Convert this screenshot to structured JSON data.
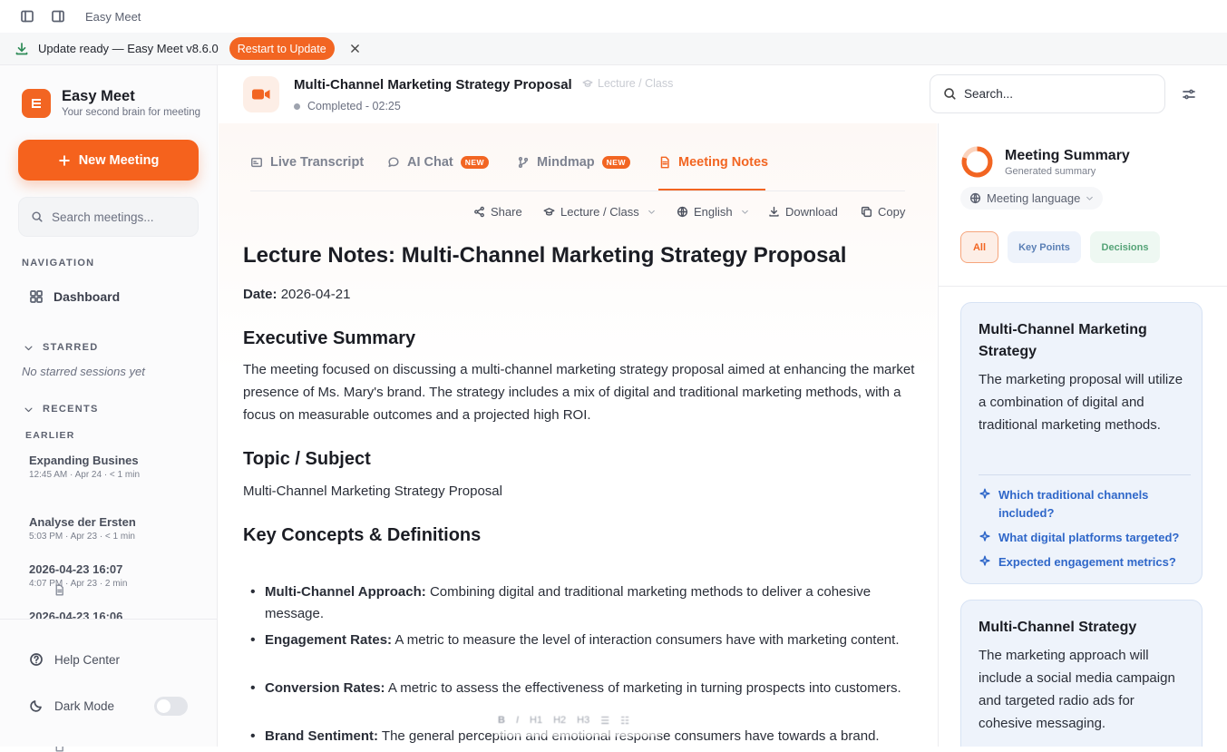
{
  "window": {
    "title": "Easy Meet"
  },
  "banner": {
    "message": "Update ready — Easy Meet v8.6.0",
    "restart_label": "Restart to Update"
  },
  "brand": {
    "name": "Easy Meet",
    "tagline": "Your second brain for meeting"
  },
  "sidebar": {
    "new_meeting_label": "New Meeting",
    "search_placeholder": "Search meetings...",
    "navigation_label": "NAVIGATION",
    "dashboard_label": "Dashboard",
    "starred_label": "STARRED",
    "no_starred": "No starred sessions yet",
    "recents_label": "RECENTS",
    "earlier_label": "EARLIER",
    "recents": [
      {
        "title": "Expanding Busines",
        "meta": "12:45 AM · Apr 24 · < 1 min"
      },
      {
        "title": "Analyse der Ersten",
        "meta": "5:03 PM · Apr 23 · < 1 min"
      },
      {
        "title": "2026-04-23 16:07",
        "meta": "4:07 PM · Apr 23 · 2 min"
      },
      {
        "title": "2026-04-23 16:06",
        "meta": ""
      }
    ],
    "help_label": "Help Center",
    "dark_mode_label": "Dark Mode",
    "dark_mode_on": false
  },
  "meeting": {
    "title": "Multi-Channel Marketing Strategy Proposal",
    "type_tag": "Lecture / Class",
    "status": "Completed - 02:25"
  },
  "tabs": [
    {
      "label": "Live Transcript",
      "badge": ""
    },
    {
      "label": "AI Chat",
      "badge": "NEW"
    },
    {
      "label": "Mindmap",
      "badge": "NEW"
    },
    {
      "label": "Meeting Notes",
      "badge": ""
    }
  ],
  "active_tab": "Meeting Notes",
  "toolbar": {
    "share": "Share",
    "template": "Lecture / Class",
    "language": "English",
    "download": "Download",
    "copy": "Copy"
  },
  "notes": {
    "heading": "Lecture Notes: Multi-Channel Marketing Strategy Proposal",
    "date_label": "Date:",
    "date_value": "2026-04-21",
    "exec_heading": "Executive Summary",
    "exec_lines": [
      "The meeting focused on discussing a multi-channel marketing strategy proposal aimed at enhancing the market",
      "presence of Ms. Mary's brand. The strategy includes a mix of digital and traditional marketing methods, with a",
      "focus on measurable outcomes and a projected high ROI."
    ],
    "topic_heading": "Topic / Subject",
    "topic_text": "Multi-Channel Marketing Strategy Proposal",
    "concepts_heading": "Key Concepts & Definitions",
    "concepts": [
      {
        "term": "Multi-Channel Approach:",
        "def": "Combining digital and traditional marketing methods to deliver a cohesive message."
      },
      {
        "term": "Engagement Rates:",
        "def": "A metric to measure the level of interaction consumers have with marketing content."
      },
      {
        "term": "Conversion Rates:",
        "def": "A metric to assess the effectiveness of marketing in turning prospects into customers."
      },
      {
        "term": "Brand Sentiment:",
        "def": "The general perception and emotional response consumers have towards a brand."
      }
    ]
  },
  "format_bar": {
    "bold": "B",
    "italic": "I",
    "h1": "H1",
    "h2": "H2",
    "h3": "H3"
  },
  "search": {
    "placeholder": "Search..."
  },
  "summary": {
    "title": "Meeting Summary",
    "subtitle": "Generated summary",
    "language_label": "Meeting language",
    "filters": [
      "All",
      "Key Points",
      "Decisions"
    ],
    "cards": [
      {
        "title": "Multi-Channel Marketing Strategy",
        "body": "The marketing proposal will utilize a combination of digital and traditional marketing methods.",
        "questions": [
          "Which traditional channels included?",
          "What digital platforms targeted?",
          "Expected engagement metrics?"
        ]
      },
      {
        "title": "Multi-Channel Strategy",
        "body": "The marketing approach will include a social media campaign and targeted radio ads for cohesive messaging.",
        "questions": []
      }
    ]
  },
  "colors": {
    "accent": "#f26522",
    "link": "#2f67c9",
    "card_bg": "#eef3fb"
  }
}
